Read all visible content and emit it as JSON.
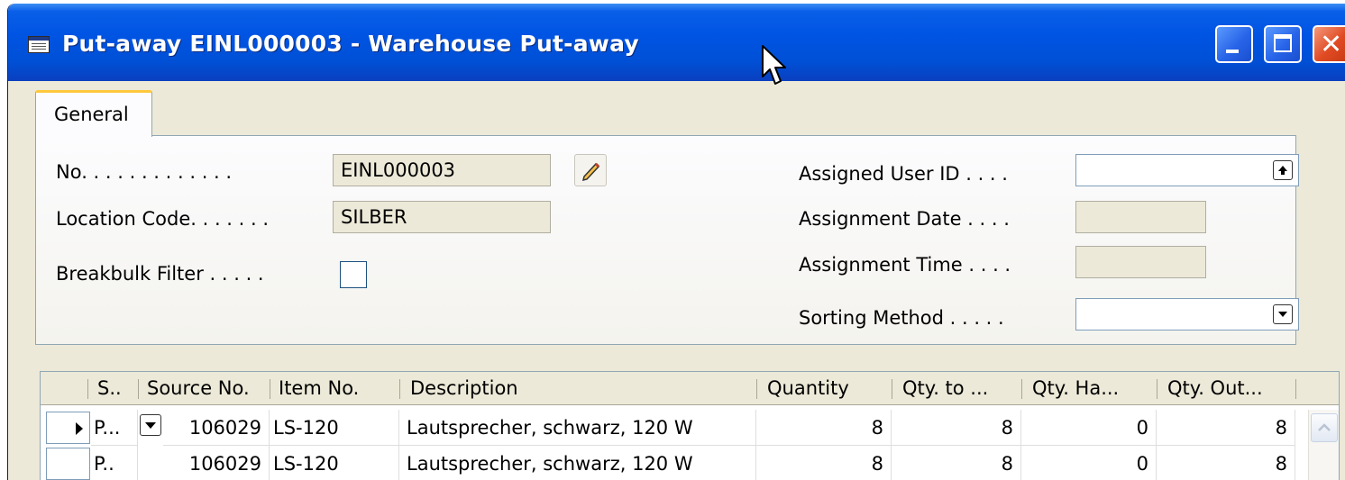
{
  "window": {
    "title": "Put-away EINL000003 - Warehouse Put-away",
    "colors": {
      "titlebar": "#0054e3",
      "tab_accent": "#ffc83c",
      "face": "#ece9d8"
    },
    "icons": [
      "table-icon",
      "minimize-icon",
      "maximize-icon",
      "close-icon"
    ]
  },
  "tabs": [
    {
      "label": "General",
      "selected": true
    }
  ],
  "general": {
    "no_label": "No. . . . . . . . . . . . .",
    "no_value": "EINL000003",
    "location_label": "Location Code. . . . . . .",
    "location_value": "SILBER",
    "breakbulk_label": "Breakbulk Filter . . . . .",
    "breakbulk_checked": false,
    "assigned_user_label": "Assigned User ID . . . .",
    "assigned_user_value": "",
    "assignment_date_label": "Assignment Date . . . .",
    "assignment_date_value": "",
    "assignment_time_label": "Assignment Time . . . .",
    "assignment_time_value": "",
    "sorting_method_label": "Sorting Method . . . . .",
    "sorting_method_value": ""
  },
  "lines": {
    "headers": [
      "S..",
      "Source No.",
      "Item No.",
      "Description",
      "Quantity",
      "Qty. to ...",
      "Qty. Ha...",
      "Qty. Out..."
    ],
    "rows": [
      {
        "s": "P...",
        "source_no": "106029",
        "item_no": "LS-120",
        "description": "Lautsprecher, schwarz, 120 W",
        "quantity": "8",
        "qty_to": "8",
        "qty_handled": "0",
        "qty_outstanding": "8"
      },
      {
        "s": "P..",
        "source_no": "106029",
        "item_no": "LS-120",
        "description": "Lautsprecher, schwarz, 120 W",
        "quantity": "8",
        "qty_to": "8",
        "qty_handled": "0",
        "qty_outstanding": "8"
      }
    ]
  }
}
